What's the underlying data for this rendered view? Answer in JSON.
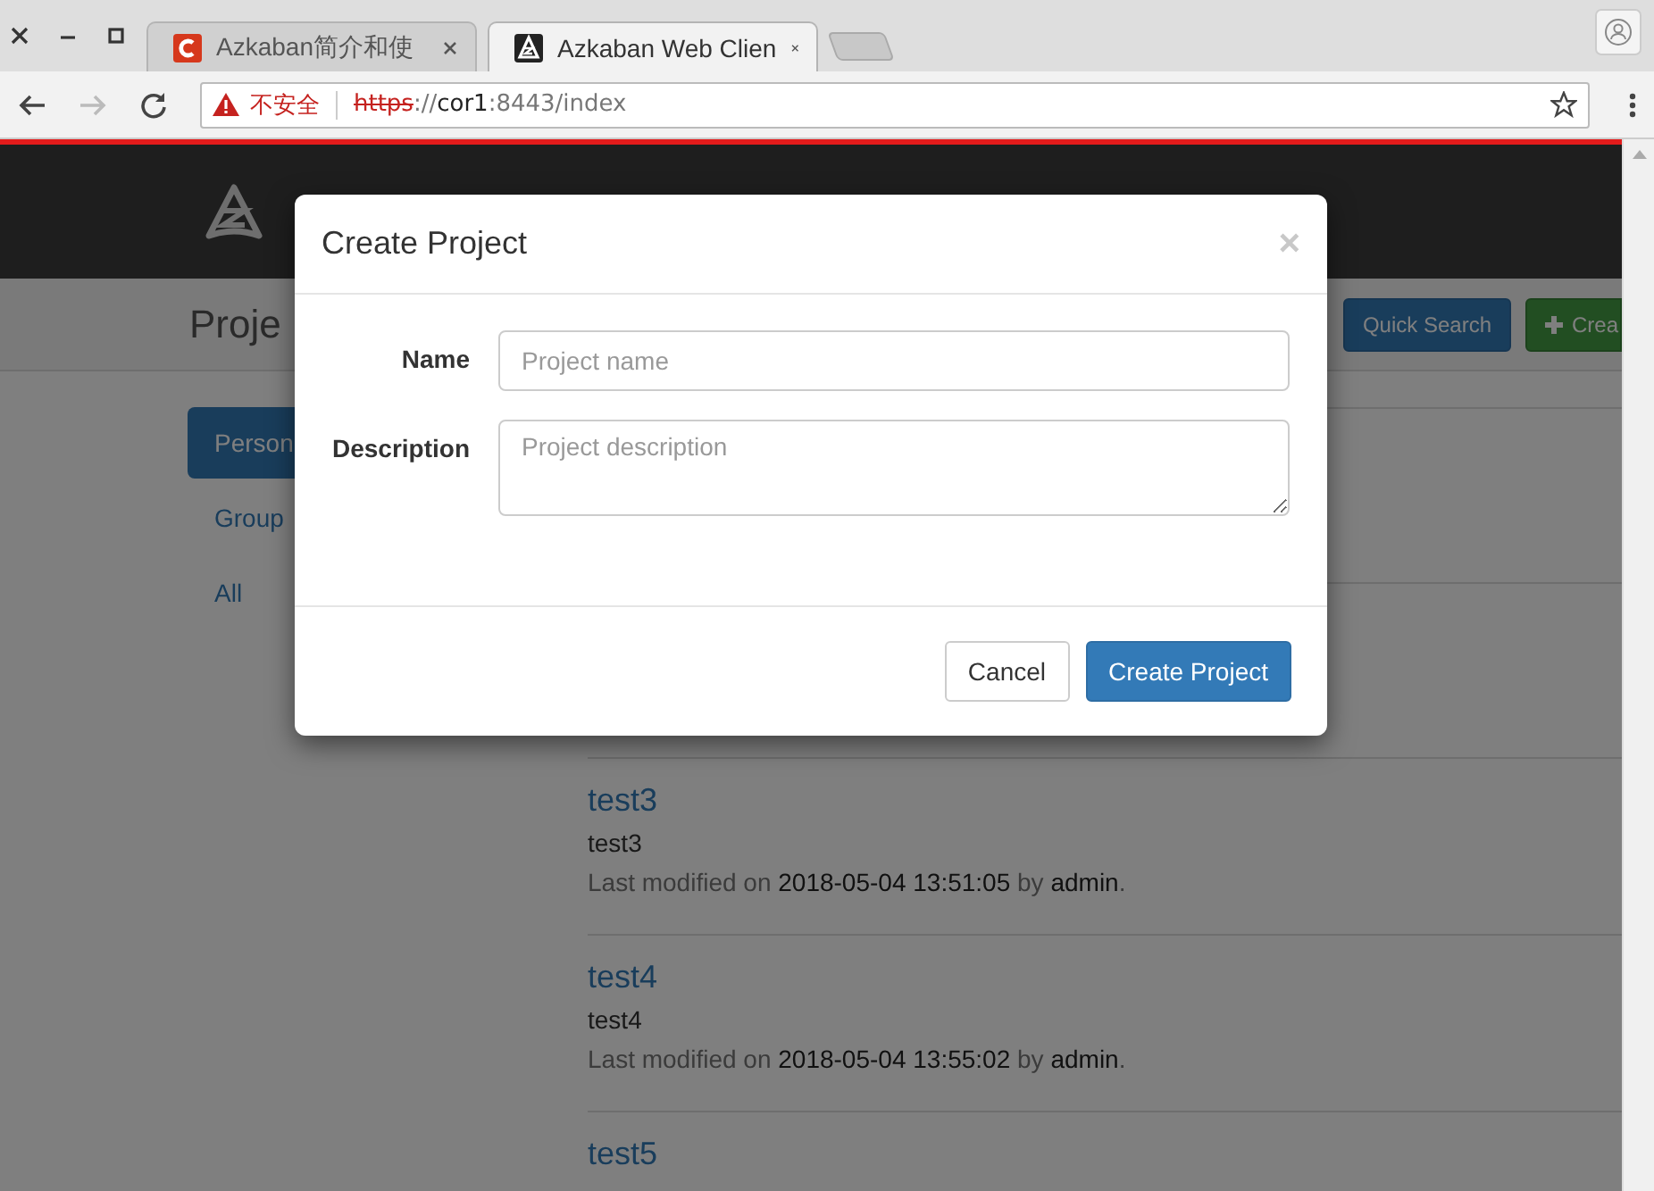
{
  "browser": {
    "tabs": [
      {
        "title": "Azkaban简介和使",
        "selected": false
      },
      {
        "title": "Azkaban Web Clien",
        "selected": true
      }
    ],
    "security_label": "不安全",
    "url": {
      "scheme": "https",
      "separator": "://",
      "host": "cor1",
      "rest": ":8443/index"
    }
  },
  "header": {
    "title": "Proje",
    "buttons": [
      {
        "label": "Quick Search",
        "kind": "primary"
      },
      {
        "label": "Crea",
        "kind": "success"
      }
    ]
  },
  "sidebar": {
    "items": [
      {
        "label": "Person",
        "selected": true
      },
      {
        "label": "Group",
        "selected": false
      },
      {
        "label": "All",
        "selected": false
      }
    ]
  },
  "projects": [
    {
      "name": "test3",
      "description": "test3",
      "modified_prefix": "Last modified on",
      "modified_time": "2018-05-04 13:51:05",
      "by": "by",
      "user": "admin",
      "end": "."
    },
    {
      "name": "test4",
      "description": "test4",
      "modified_prefix": "Last modified on",
      "modified_time": "2018-05-04 13:55:02",
      "by": "by",
      "user": "admin",
      "end": "."
    },
    {
      "name": "test5"
    }
  ],
  "modal": {
    "title": "Create Project",
    "close": "×",
    "fields": [
      {
        "label": "Name",
        "placeholder": "Project name",
        "kind": "input"
      },
      {
        "label": "Description",
        "placeholder": "Project description",
        "kind": "textarea"
      }
    ],
    "buttons": [
      {
        "label": "Cancel",
        "kind": "default"
      },
      {
        "label": "Create Project",
        "kind": "primary"
      }
    ]
  }
}
